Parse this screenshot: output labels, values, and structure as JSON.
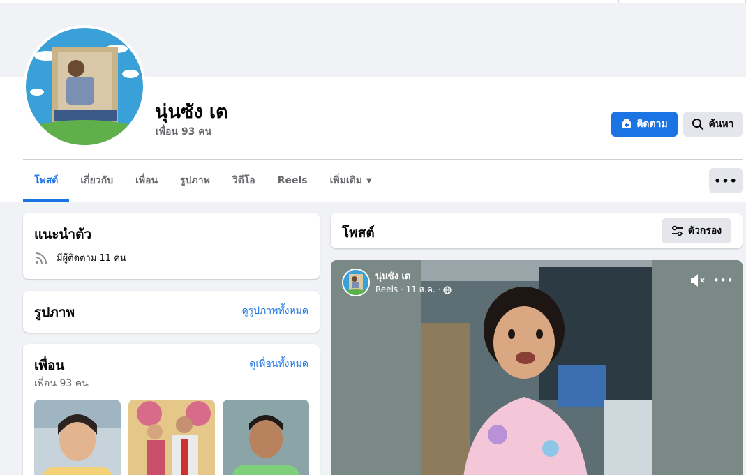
{
  "profile": {
    "name": "นุ่นซัง เต",
    "friends_summary": "เพื่อน 93 คน"
  },
  "actions": {
    "follow_label": "ติดตาม",
    "search_label": "ค้นหา",
    "more_icon": "more-horizontal-icon"
  },
  "tabs": [
    {
      "label": "โพสต์",
      "active": true
    },
    {
      "label": "เกี่ยวกับ"
    },
    {
      "label": "เพื่อน"
    },
    {
      "label": "รูปภาพ"
    },
    {
      "label": "วิดีโอ"
    },
    {
      "label": "Reels"
    },
    {
      "label": "เพิ่มเติม"
    }
  ],
  "intro": {
    "title": "แนะนำตัว",
    "followers_text": "มีผู้ติดตาม 11 คน"
  },
  "photos": {
    "title": "รูปภาพ",
    "see_all": "ดูรูปภาพทั้งหมด"
  },
  "friends": {
    "title": "เพื่อน",
    "subtitle": "เพื่อน 93 คน",
    "see_all": "ดูเพื่อนทั้งหมด"
  },
  "posts": {
    "title": "โพสต์",
    "filter_label": "ตัวกรอง"
  },
  "reel": {
    "author": "นุ่นซัง เต",
    "meta": "Reels · 11 ส.ค. ·"
  },
  "colors": {
    "accent": "#1b74e4",
    "page_bg": "#f0f2f5",
    "secondary_btn": "#e4e6eb"
  }
}
